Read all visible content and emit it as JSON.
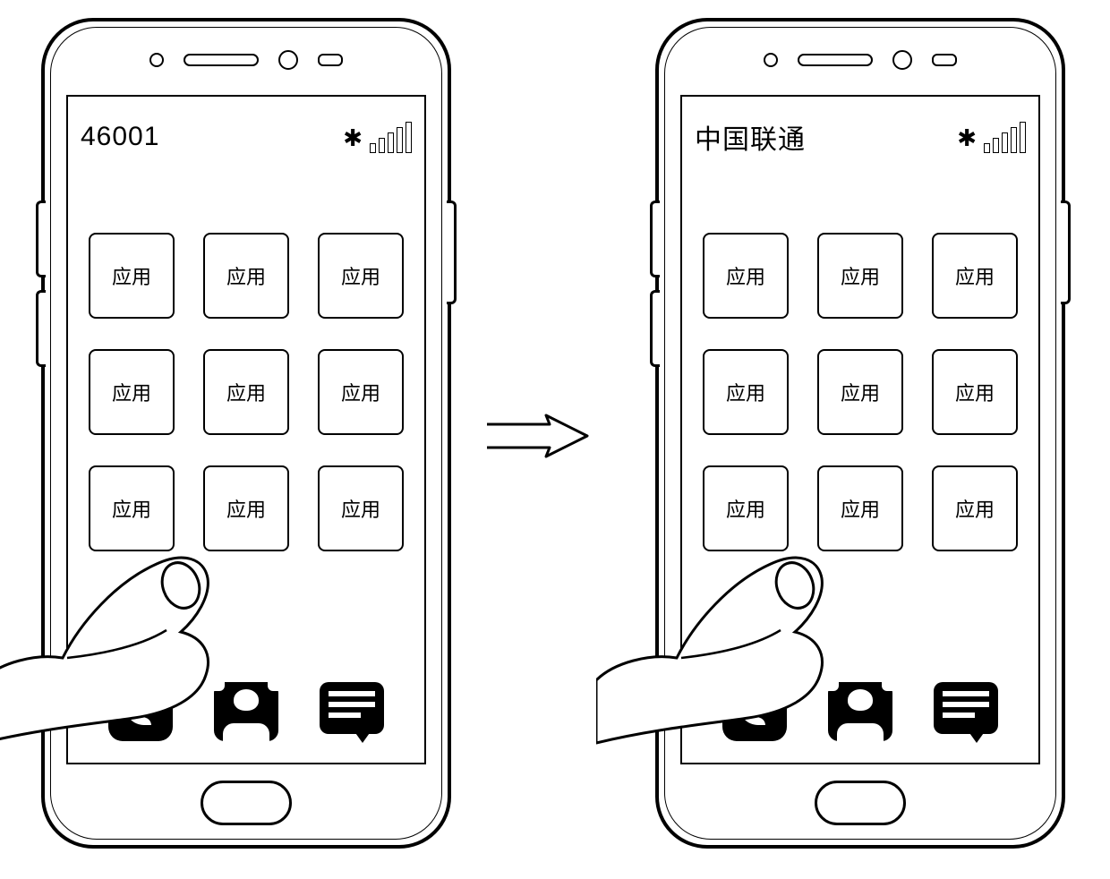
{
  "phones": {
    "left": {
      "carrier": "46001",
      "app_label": "应用"
    },
    "right": {
      "carrier": "中国联通",
      "app_label": "应用"
    }
  },
  "grid_rows": 3,
  "grid_cols": 3,
  "icons": {
    "carrier_logo": "knot-icon",
    "signal": 5
  }
}
